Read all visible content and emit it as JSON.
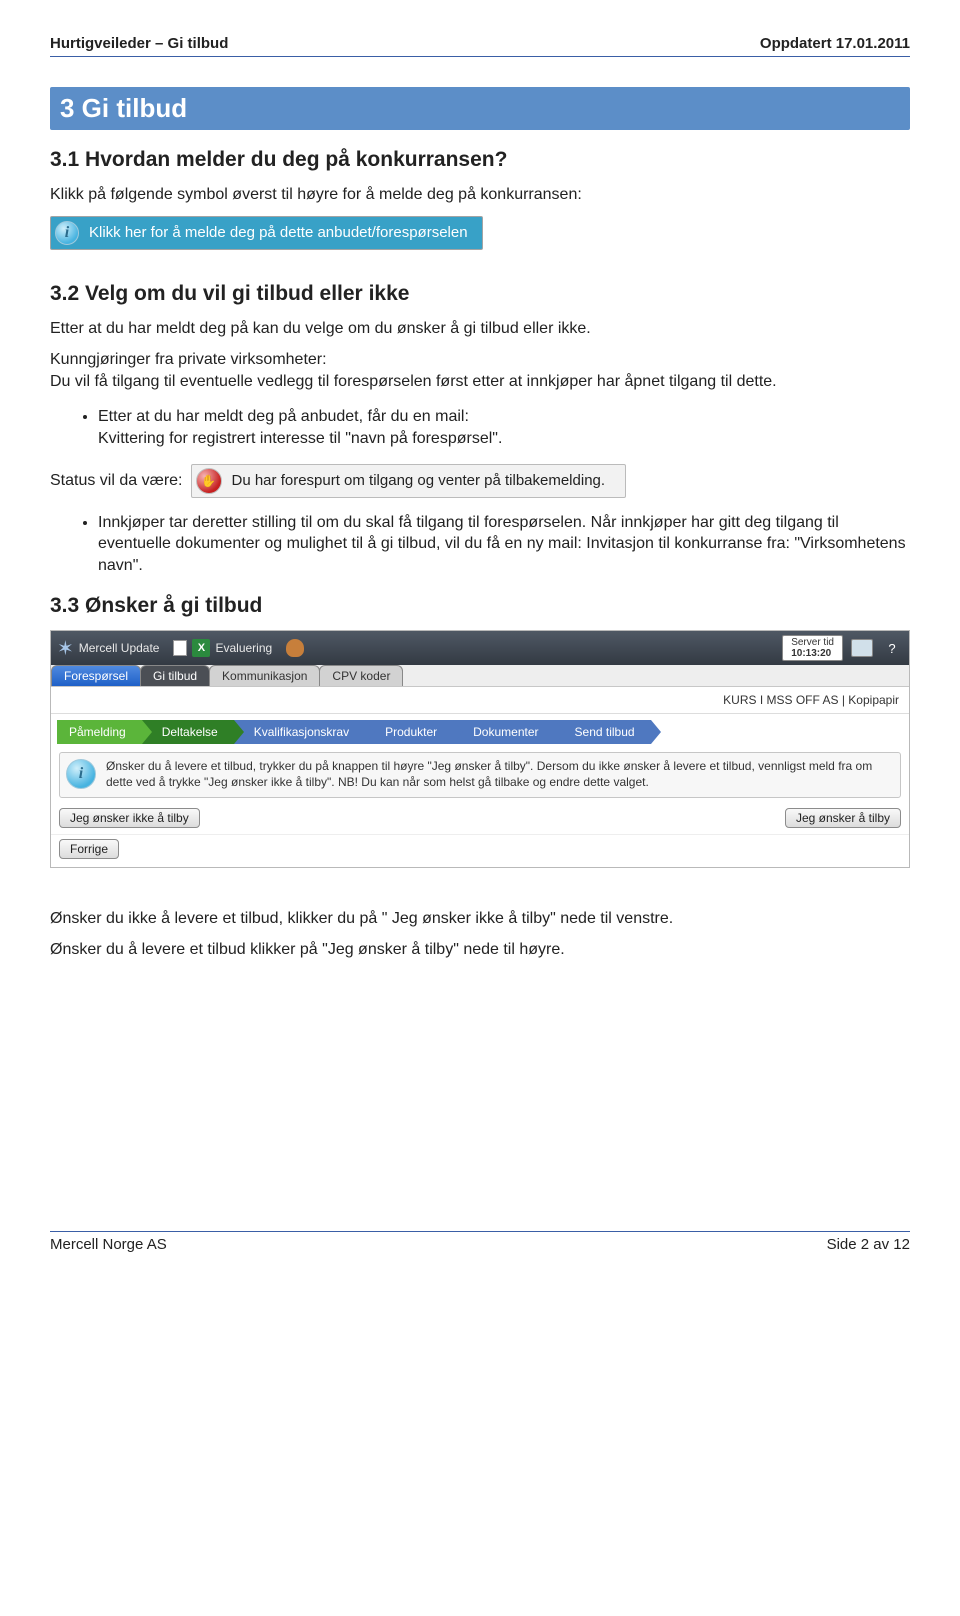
{
  "header": {
    "left": "Hurtigveileder – Gi tilbud",
    "right": "Oppdatert 17.01.2011"
  },
  "section": {
    "banner": "3  Gi tilbud"
  },
  "s31": {
    "heading": "3.1  Hvordan melder du deg på konkurransen?",
    "p1": "Klikk på følgende symbol øverst til høyre for å melde deg på konkurransen:",
    "callout": "Klikk her for å melde deg på dette anbudet/forespørselen"
  },
  "s32": {
    "heading": "3.2  Velg om du vil gi tilbud eller ikke",
    "p1": "Etter at du har meldt deg på kan du velge om du ønsker å gi tilbud eller ikke.",
    "p2": "Kunngjøringer fra private virksomheter:\nDu vil få tilgang til eventuelle vedlegg til forespørselen først etter at innkjøper har åpnet tilgang til dette.",
    "bullet1a": "Etter at du har meldt deg på anbudet, får du en mail:",
    "bullet1b": "Kvittering for registrert interesse til \"navn på forespørsel\".",
    "status_label": "Status vil da være:",
    "status_text": "Du har forespurt om tilgang og venter på tilbakemelding.",
    "bullet2": "Innkjøper tar deretter stilling til om du skal få tilgang til forespørselen. Når innkjøper har gitt deg tilgang til eventuelle dokumenter og mulighet til å gi tilbud, vil du få en ny mail: Invitasjon til konkurranse fra: \"Virksomhetens navn\"."
  },
  "s33": {
    "heading": "3.3  Ønsker å gi tilbud"
  },
  "app": {
    "toolbar": {
      "update": "Mercell Update",
      "eval": "Evaluering",
      "server_label": "Server tid",
      "server_time": "10:13:20"
    },
    "tabs": [
      "Forespørsel",
      "Gi tilbud",
      "Kommunikasjon",
      "CPV koder"
    ],
    "path": "KURS I MSS OFF AS | Kopipapir",
    "chevrons": [
      "Påmelding",
      "Deltakelse",
      "Kvalifikasjonskrav",
      "Produkter",
      "Dokumenter",
      "Send tilbud"
    ],
    "info": "Ønsker du å levere et tilbud, trykker du på knappen til høyre \"Jeg ønsker å tilby\". Dersom du ikke ønsker å levere et tilbud, vennligst meld fra om dette ved å trykke \"Jeg ønsker ikke å tilby\". NB! Du kan når som helst gå tilbake og endre dette valget.",
    "btn_no": "Jeg ønsker ikke å tilby",
    "btn_yes": "Jeg ønsker å tilby",
    "btn_prev": "Forrige"
  },
  "post": {
    "p1": "Ønsker du ikke å levere et tilbud, klikker du på \" Jeg ønsker ikke å tilby\" nede til venstre.",
    "p2": "Ønsker du å levere et tilbud klikker på \"Jeg ønsker å tilby\" nede til høyre."
  },
  "footer": {
    "left": "Mercell Norge AS",
    "right": "Side 2 av 12"
  }
}
